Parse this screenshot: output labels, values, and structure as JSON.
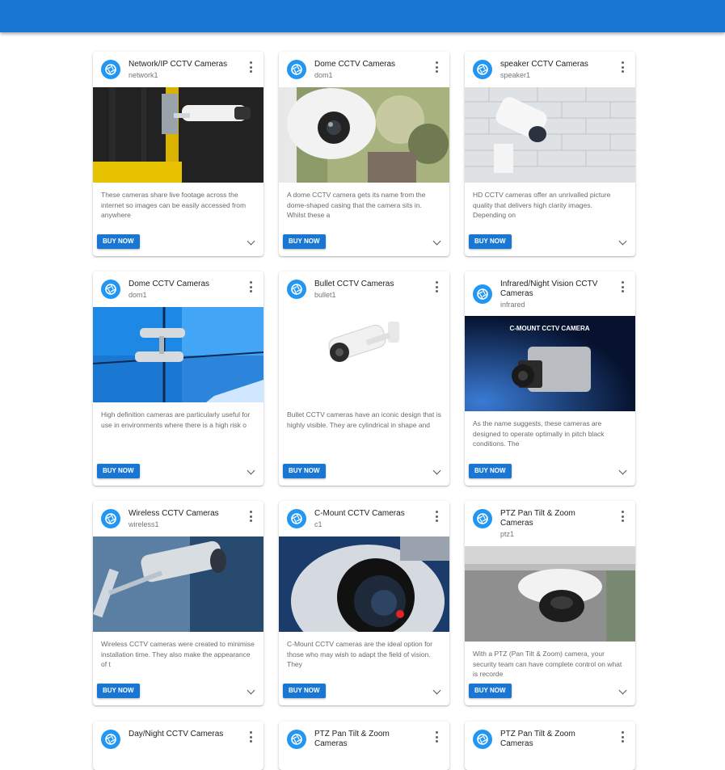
{
  "app": {
    "bar_color": "#1976d2"
  },
  "cards": [
    {
      "title": "Network/IP CCTV Cameras",
      "subtitle": "network1",
      "description": "These cameras share live footage across the internet so images can be easily accessed from anywhere",
      "button": "BUY NOW",
      "image": "bullet-camera-on-pole"
    },
    {
      "title": "Dome CCTV Cameras",
      "subtitle": "dom1",
      "description": "A dome CCTV camera gets its name from the dome-shaped casing that the camera sits in. Whilst these a",
      "button": "BUY NOW",
      "image": "white-dome-camera-garden"
    },
    {
      "title": "speaker CCTV Cameras",
      "subtitle": "speaker1",
      "description": "HD CCTV cameras offer an unrivalled picture quality that delivers high clarity images. Depending on",
      "button": "BUY NOW",
      "image": "camera-on-brick-wall"
    },
    {
      "title": "Dome CCTV Cameras",
      "subtitle": "dom1",
      "description": "High definition cameras are particularly useful for use in environments where there is a high risk o",
      "button": "BUY NOW",
      "image": "cameras-on-glass-building"
    },
    {
      "title": "Bullet CCTV Cameras",
      "subtitle": "bullet1",
      "description": "Bullet CCTV cameras have an iconic design that is highly visible. They are cylindrical in shape and",
      "button": "BUY NOW",
      "image": "white-bullet-camera"
    },
    {
      "title": "Infrared/Night Vision CCTV Cameras",
      "subtitle": "infrared",
      "description": "As the name suggests, these cameras are designed to operate optimally in pitch black conditions. The",
      "button": "BUY NOW",
      "image": "c-mount-camera",
      "image_caption": "C-MOUNT CCTV CAMERA"
    },
    {
      "title": "Wireless CCTV Cameras",
      "subtitle": "wireless1",
      "description": "Wireless CCTV cameras were created to minimise installation time. They also make the appearance of t",
      "button": "BUY NOW",
      "image": "wall-camera-blue"
    },
    {
      "title": "C-Mount CCTV Cameras",
      "subtitle": "c1",
      "description": "C-Mount CCTV cameras are the ideal option for those who may wish to adapt the field of vision. They",
      "button": "BUY NOW",
      "image": "camera-lens-closeup"
    },
    {
      "title": "PTZ Pan Tilt & Zoom Cameras",
      "subtitle": "ptz1",
      "description": "With a PTZ (Pan Tilt & Zoom) camera, your security team can have complete control on what is recorde",
      "button": "BUY NOW",
      "image": "ceiling-dome-camera"
    },
    {
      "title": "Day/Night CCTV Cameras"
    },
    {
      "title": "PTZ Pan Tilt & Zoom Cameras"
    },
    {
      "title": "PTZ Pan Tilt & Zoom Cameras"
    }
  ]
}
